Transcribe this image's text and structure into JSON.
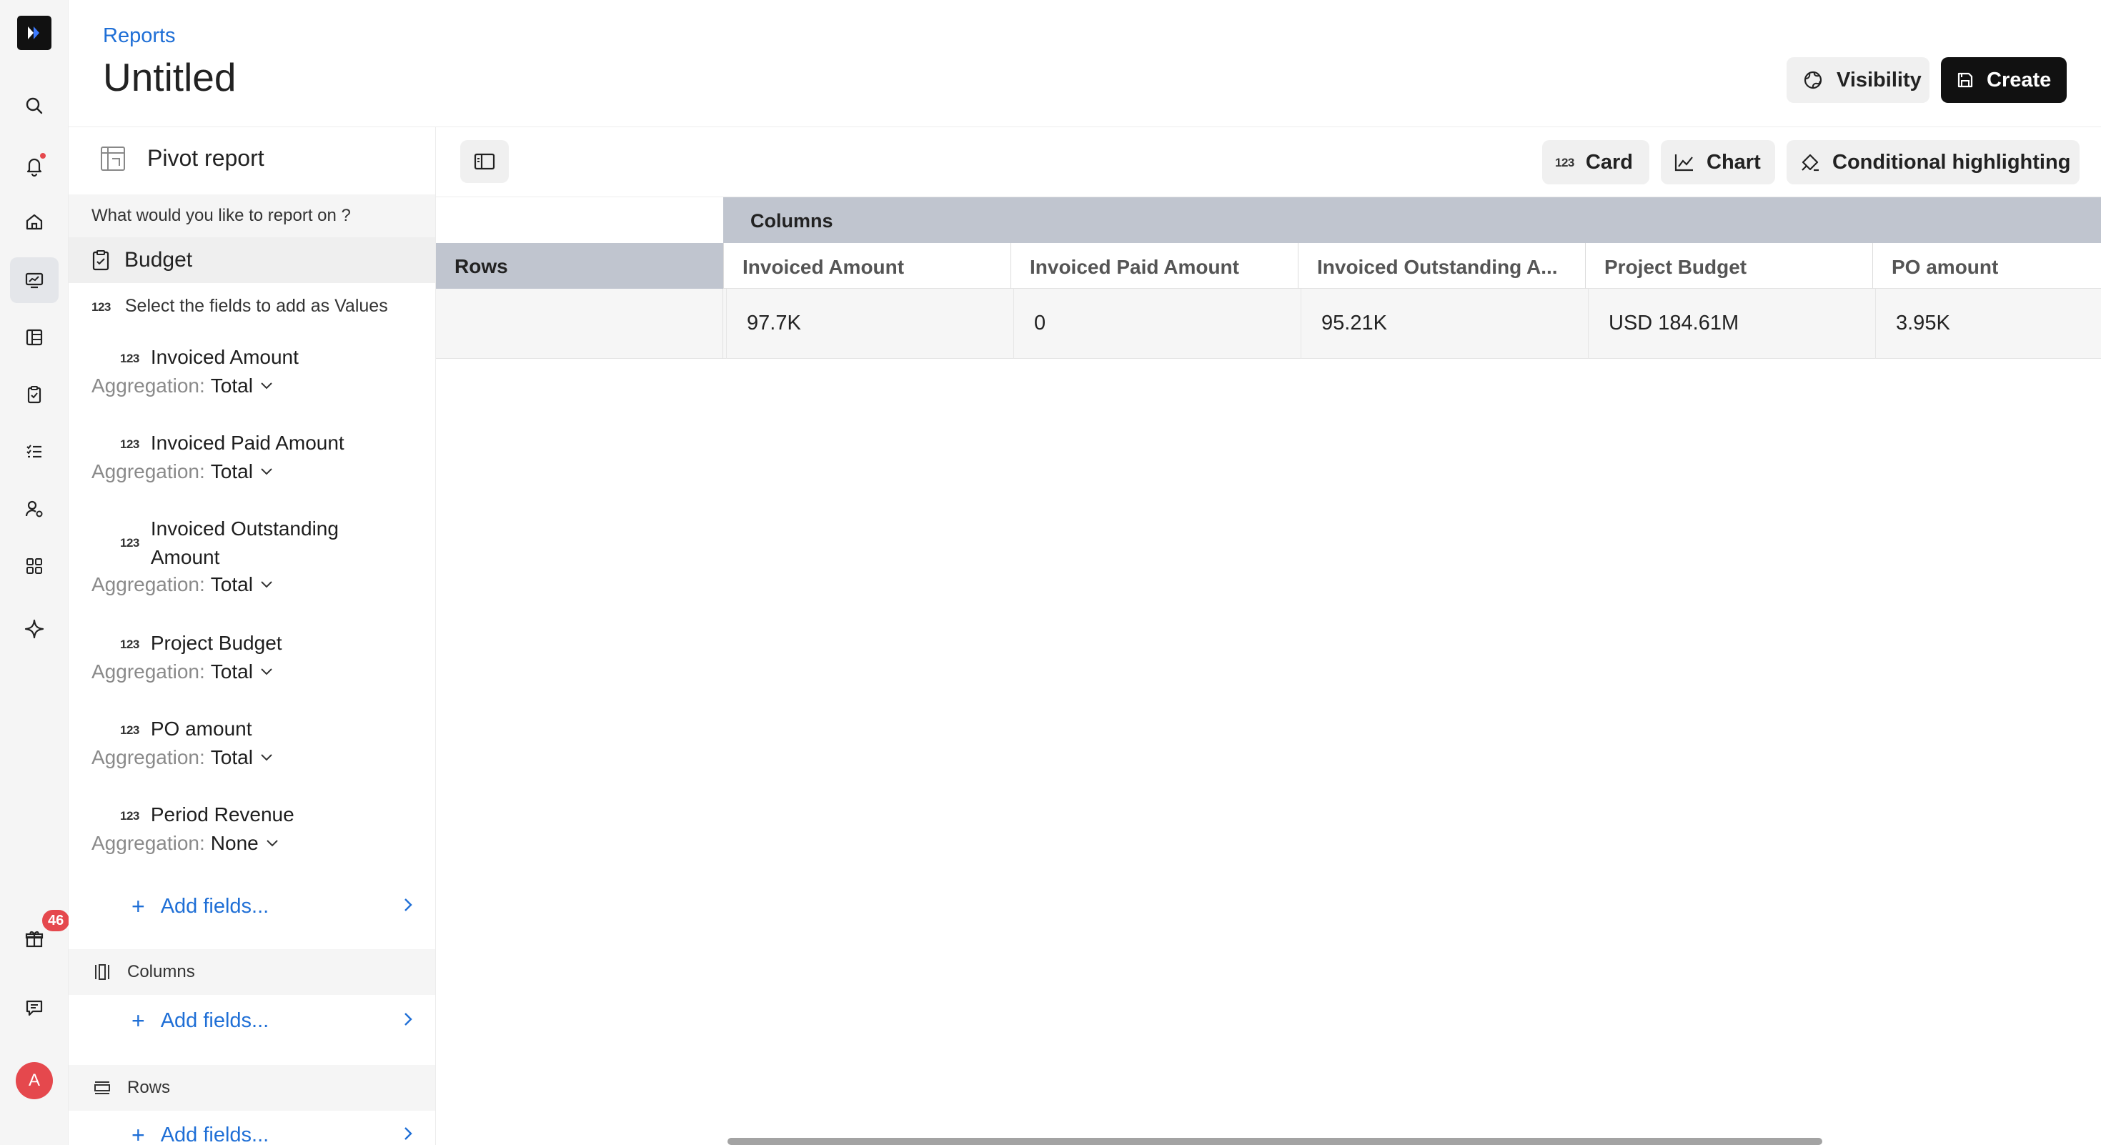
{
  "header": {
    "breadcrumb": "Reports",
    "title": "Untitled",
    "visibility_label": "Visibility",
    "create_label": "Create"
  },
  "rail": {
    "items": [
      "search-icon",
      "bell-icon",
      "home-icon",
      "reports-icon",
      "table-icon",
      "clipboard-icon",
      "checklist-icon",
      "user-settings-icon",
      "apps-icon",
      "sparkle-icon",
      "gift-icon",
      "chat-icon"
    ],
    "gift_badge": "46",
    "avatar_initial": "A",
    "accent_red": "#e5484d"
  },
  "panel": {
    "title": "Pivot report",
    "question": "What would you like to report on ?",
    "dataset": "Budget",
    "values_header": "Select the fields to add as Values",
    "num_icon": "123",
    "agg_prefix": "Aggregation:",
    "fields": [
      {
        "name": "Invoiced Amount",
        "aggregation": "Total"
      },
      {
        "name": "Invoiced Paid Amount",
        "aggregation": "Total"
      },
      {
        "name": "Invoiced Outstanding Amount",
        "aggregation": "Total"
      },
      {
        "name": "Project Budget",
        "aggregation": "Total"
      },
      {
        "name": "PO amount",
        "aggregation": "Total"
      },
      {
        "name": "Period Revenue",
        "aggregation": "None"
      }
    ],
    "add_fields_label": "Add fields...",
    "columns_label": "Columns",
    "rows_label": "Rows"
  },
  "toolbar": {
    "card_label": "Card",
    "chart_label": "Chart",
    "highlight_label": "Conditional highlighting"
  },
  "pivot": {
    "columns_band": "Columns",
    "rows_label": "Rows",
    "headers": [
      "Invoiced Amount",
      "Invoiced Paid Amount",
      "Invoiced Outstanding A...",
      "Project Budget",
      "PO amount"
    ],
    "values": [
      "97.7K",
      "0",
      "95.21K",
      "USD 184.61M",
      "3.95K"
    ]
  },
  "colors": {
    "link_blue": "#1f6fd6",
    "header_band": "#c0c5cf"
  }
}
